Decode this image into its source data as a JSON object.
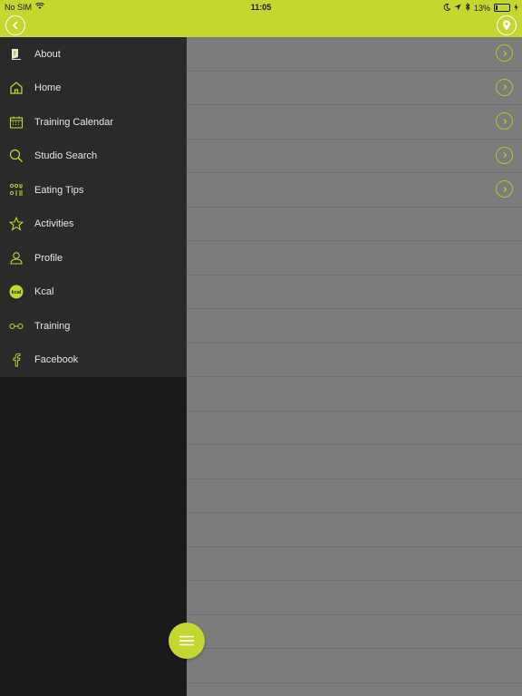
{
  "status": {
    "carrier": "No SIM",
    "time": "11:05",
    "battery": "13%",
    "battery_level": 0.13
  },
  "header": {
    "back_icon": "chevron-left-icon",
    "location_icon": "location-pin-icon"
  },
  "drawer": {
    "items": [
      {
        "label": "About",
        "icon": "about-icon"
      },
      {
        "label": "Home",
        "icon": "home-icon"
      },
      {
        "label": "Training Calendar",
        "icon": "calendar-icon"
      },
      {
        "label": "Studio Search",
        "icon": "search-icon"
      },
      {
        "label": "Eating Tips",
        "icon": "eating-tips-icon"
      },
      {
        "label": "Activities",
        "icon": "star-icon"
      },
      {
        "label": "Profile",
        "icon": "profile-icon"
      },
      {
        "label": "Kcal",
        "icon": "kcal-icon",
        "badge": "kcal"
      },
      {
        "label": "Training",
        "icon": "dumbbell-icon"
      },
      {
        "label": "Facebook",
        "icon": "facebook-icon"
      }
    ]
  },
  "colors": {
    "accent": "#c4d630",
    "drawer_bg": "#1a1a1a",
    "menu_bg": "#2a2a2a",
    "content_bg": "#7c7c7c"
  }
}
